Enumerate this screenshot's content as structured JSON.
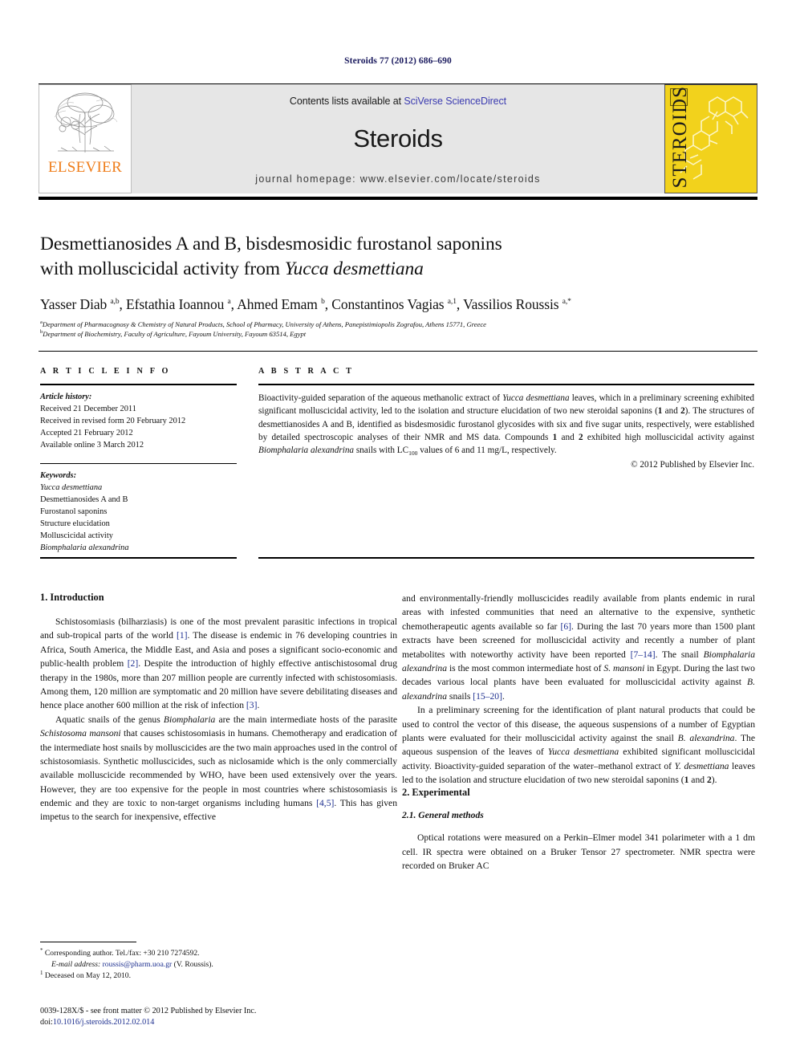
{
  "running_head": "Steroids 77 (2012) 686–690",
  "masthead": {
    "publisher_name": "ELSEVIER",
    "contents_prefix": "Contents lists available at ",
    "contents_link": "SciVerse ScienceDirect",
    "journal_name": "Steroids",
    "homepage": "journal homepage: www.elsevier.com/locate/steroids",
    "cover_title": "STEROIDS",
    "cover_color": "#f2d21c",
    "link_color": "#3b3bb0",
    "elsevier_orange": "#ef7d1a"
  },
  "article": {
    "title_line1": "Desmettianosides A and B, bisdesmosidic furostanol saponins",
    "title_line2_pre": "with molluscicidal activity from ",
    "title_line2_italic": "Yucca desmettiana",
    "authors_html": "Yasser Diab <sup>a,b</sup>, Efstathia Ioannou <sup>a</sup>, Ahmed Emam <sup>b</sup>, Constantinos Vagias <sup>a,1</sup>, Vassilios Roussis <sup>a,*</sup>",
    "affiliation_a": "Department of Pharmacognosy & Chemistry of Natural Products, School of Pharmacy, University of Athens, Panepistimiopolis Zografou, Athens 15771, Greece",
    "affiliation_b": "Department of Biochemistry, Faculty of Agriculture, Fayoum University, Fayoum 63514, Egypt"
  },
  "article_info": {
    "heading": "A R T I C L E   I N F O",
    "history_label": "Article history:",
    "history": [
      "Received 21 December 2011",
      "Received in revised form 20 February 2012",
      "Accepted 21 February 2012",
      "Available online 3 March 2012"
    ],
    "keywords_label": "Keywords:",
    "keywords": [
      "Yucca desmettiana",
      "Desmettianosides A and B",
      "Furostanol saponins",
      "Structure elucidation",
      "Molluscicidal activity",
      "Biomphalaria alexandrina"
    ]
  },
  "abstract": {
    "heading": "A B S T R A C T",
    "body_html": "Bioactivity-guided separation of the aqueous methanolic extract of <i>Yucca desmettiana</i> leaves, which in a preliminary screening exhibited significant molluscicidal activity, led to the isolation and structure elucidation of two new steroidal saponins (<b>1</b> and <b>2</b>). The structures of desmettianosides A and B, identified as bisdesmosidic furostanol glycosides with six and five sugar units, respectively, were established by detailed spectroscopic analyses of their NMR and MS data. Compounds <b>1</b> and <b>2</b> exhibited high molluscicidal activity against <i>Biomphalaria alexandrina</i> snails with LC<sub>100</sub> values of 6 and 11 mg/L, respectively.",
    "copyright": "© 2012 Published by Elsevier Inc."
  },
  "sections": {
    "introduction_heading": "1. Introduction",
    "experimental_heading": "2. Experimental",
    "general_methods_heading": "2.1. General methods"
  },
  "body": {
    "left_p1_html": "Schistosomiasis (bilharziasis) is one of the most prevalent parasitic infections in tropical and sub-tropical parts of the world <span class=\"ref\">[1]</span>. The disease is endemic in 76 developing countries in Africa, South America, the Middle East, and Asia and poses a significant socio-economic and public-health problem <span class=\"ref\">[2]</span>. Despite the introduction of highly effective antischistosomal drug therapy in the 1980s, more than 207 million people are currently infected with schistosomiasis. Among them, 120 million are symptomatic and 20 million have severe debilitating diseases and hence place another 600 million at the risk of infection <span class=\"ref\">[3]</span>.",
    "left_p2_html": "Aquatic snails of the genus <i>Biomphalaria</i> are the main intermediate hosts of the parasite <i>Schistosoma mansoni</i> that causes schistosomiasis in humans. Chemotherapy and eradication of the intermediate host snails by molluscicides are the two main approaches used in the control of schistosomiasis. Synthetic molluscicides, such as niclosamide which is the only commercially available molluscicide recommended by WHO, have been used extensively over the years. However, they are too expensive for the people in most countries where schistosomiasis is endemic and they are toxic to non-target organisms including humans <span class=\"ref\">[4,5]</span>. This has given impetus to the search for inexpensive, effective",
    "right_p1_html": "and environmentally-friendly molluscicides readily available from plants endemic in rural areas with infested communities that need an alternative to the expensive, synthetic chemotherapeutic agents available so far <span class=\"ref\">[6]</span>. During the last 70 years more than 1500 plant extracts have been screened for molluscicidal activity and recently a number of plant metabolites with noteworthy activity have been reported <span class=\"ref\">[7–14]</span>. The snail <i>Biomphalaria alexandrina</i> is the most common intermediate host of <i>S. mansoni</i> in Egypt. During the last two decades various local plants have been evaluated for molluscicidal activity against <i>B. alexandrina</i> snails <span class=\"ref\">[15–20]</span>.",
    "right_p2_html": "In a preliminary screening for the identification of plant natural products that could be used to control the vector of this disease, the aqueous suspensions of a number of Egyptian plants were evaluated for their molluscicidal activity against the snail <i>B. alexandrina</i>. The aqueous suspension of the leaves of <i>Yucca desmettiana</i> exhibited significant molluscicidal activity. Bioactivity-guided separation of the water–methanol extract of <i>Y. desmettiana</i> leaves led to the isolation and structure elucidation of two new steroidal saponins (<b>1</b> and <b>2</b>).",
    "right_p3_html": "Optical rotations were measured on a Perkin–Elmer model 341 polarimeter with a 1 dm cell. IR spectra were obtained on a Bruker Tensor 27 spectrometer. NMR spectra were recorded on Bruker AC"
  },
  "footnotes": {
    "corresponding_html": "<span class=\"fn-sup\">*</span> Corresponding author. Tel./fax: +30 210 7274592.",
    "email_label": "E-mail address:",
    "email": "roussis@pharm.uoa.gr",
    "email_suffix": "(V. Roussis).",
    "deceased_html": "<span class=\"fn-sup\">1</span> Deceased on May 12, 2010."
  },
  "imprint": {
    "line1": "0039-128X/$ - see front matter © 2012 Published by Elsevier Inc.",
    "doi_prefix": "doi:",
    "doi": "10.1016/j.steroids.2012.02.014"
  }
}
